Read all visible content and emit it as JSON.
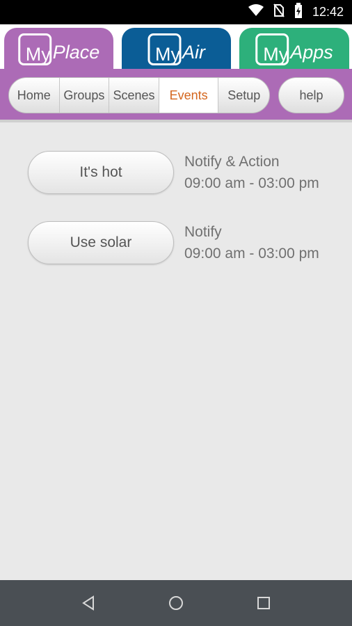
{
  "status_bar": {
    "time": "12:42",
    "icons": [
      "wifi-icon",
      "no-sim-icon",
      "battery-charging-icon"
    ]
  },
  "app_tabs": [
    {
      "label": "MyPlace",
      "my": "My",
      "name": "Place",
      "color": "#ac6bb6",
      "active": true
    },
    {
      "label": "MyAir",
      "my": "My",
      "name": "Air",
      "color": "#0b5d96",
      "active": false
    },
    {
      "label": "MyApps",
      "my": "My",
      "name": "Apps",
      "color": "#2db07b",
      "active": false
    }
  ],
  "nav": {
    "items": [
      {
        "label": "Home",
        "active": false
      },
      {
        "label": "Groups",
        "active": false
      },
      {
        "label": "Scenes",
        "active": false
      },
      {
        "label": "Events",
        "active": true
      },
      {
        "label": "Setup",
        "active": false
      }
    ],
    "help_label": "help",
    "active_color": "#d4661e"
  },
  "events": [
    {
      "name": "It's hot",
      "type": "Notify & Action",
      "time": "09:00 am - 03:00 pm"
    },
    {
      "name": "Use solar",
      "type": "Notify",
      "time": "09:00 am - 03:00 pm"
    }
  ],
  "android_nav": {
    "icons": [
      "back-icon",
      "home-icon",
      "recents-icon"
    ]
  }
}
